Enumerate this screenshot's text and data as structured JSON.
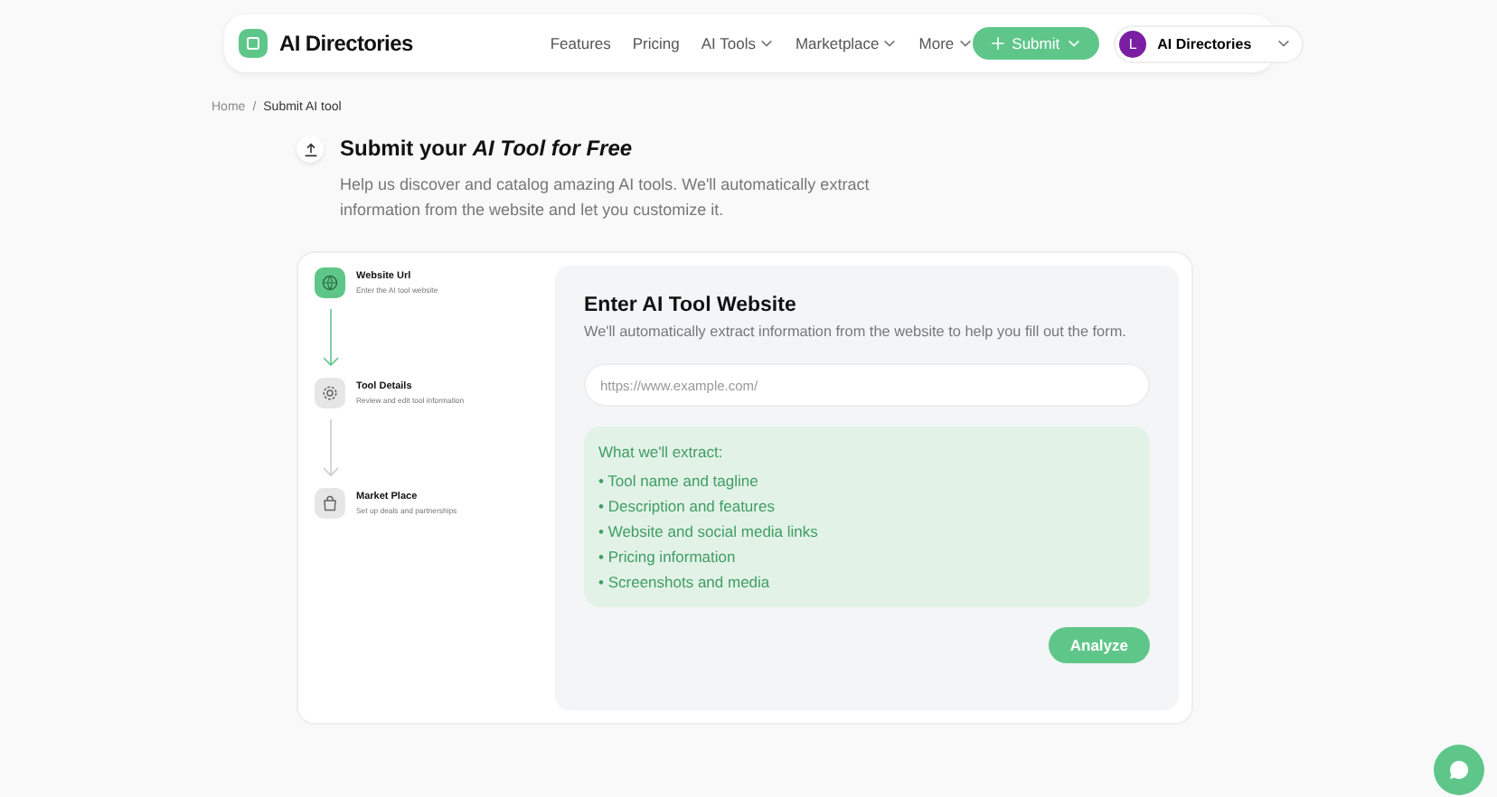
{
  "nav": {
    "brand": "AI Directories",
    "links": [
      {
        "label": "Features",
        "dropdown": false
      },
      {
        "label": "Pricing",
        "dropdown": false
      },
      {
        "label": "AI Tools",
        "dropdown": true
      },
      {
        "label": "Marketplace",
        "dropdown": true
      },
      {
        "label": "More",
        "dropdown": true
      }
    ],
    "submit_button": "Submit",
    "account": {
      "initial": "L",
      "name": "AI Directories"
    }
  },
  "breadcrumb": {
    "items": [
      "Home",
      "Submit AI tool"
    ],
    "separator": "/"
  },
  "header": {
    "title": "Submit your *AI Tool for Free*",
    "description": "Help us discover and catalog amazing AI tools. We'll automatically extract information from the website and let you customize it."
  },
  "steps": [
    {
      "kind": "globe",
      "title": "Website Url",
      "subtitle": "Enter the AI tool website",
      "active": true
    },
    {
      "kind": "gear",
      "title": "Tool Details",
      "subtitle": "Review and edit tool information",
      "active": false
    },
    {
      "kind": "bag",
      "title": "Market Place",
      "subtitle": "Set up deals and partnerships",
      "active": false
    }
  ],
  "form": {
    "title": "Enter AI Tool Website",
    "subtitle": "We'll automatically extract information from the website to help you fill out the form.",
    "url_field": {
      "placeholder": "https://www.example.com/"
    },
    "extract": {
      "heading": "What we'll extract:",
      "items": [
        "• Tool name and tagline",
        "• Description and features",
        "• Website and social media links",
        "• Pricing information",
        "• Screenshots and media"
      ]
    },
    "button": "Analyze"
  }
}
